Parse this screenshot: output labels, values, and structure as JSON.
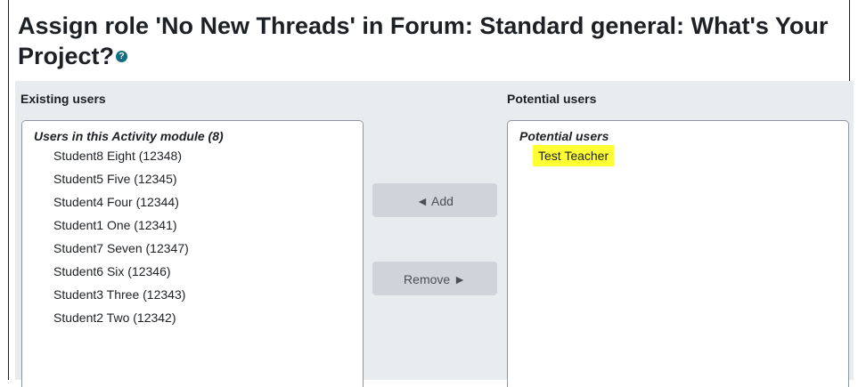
{
  "page": {
    "title": "Assign role 'No New Threads' in Forum: Standard general: What's Your Project?",
    "help_icon_glyph": "?"
  },
  "existing": {
    "heading": "Existing users",
    "group_label": "Users in this Activity module (8)",
    "users": [
      "Student8 Eight (12348)",
      "Student5 Five (12345)",
      "Student4 Four (12344)",
      "Student1 One (12341)",
      "Student7 Seven (12347)",
      "Student6 Six (12346)",
      "Student3 Three (12343)",
      "Student2 Two (12342)"
    ]
  },
  "actions": {
    "add_label": "◄ Add",
    "remove_label": "Remove ►"
  },
  "potential": {
    "heading": "Potential users",
    "group_label": "Potential users",
    "users": [
      "Test Teacher"
    ],
    "highlight_color": "#ffff33"
  }
}
